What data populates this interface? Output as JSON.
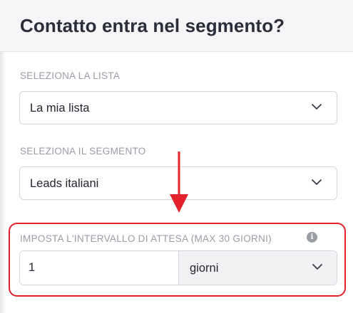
{
  "panel": {
    "title": "Contatto entra nel segmento?"
  },
  "list_field": {
    "label": "SELEZIONA LA LISTA",
    "value": "La mia lista"
  },
  "segment_field": {
    "label": "SELEZIONA IL SEGMENTO",
    "value": "Leads italiani"
  },
  "wait_field": {
    "label": "IMPOSTA L'INTERVALLO DI ATTESA (MAX 30 GIORNI)",
    "info_glyph": "i",
    "amount": "1",
    "unit": "giorni"
  },
  "colors": {
    "annotation_red": "#e5212b",
    "label_gray": "#9a9ca6",
    "header_bg": "#f6f6f8"
  },
  "icons": [
    "chevron-down-icon",
    "info-icon",
    "down-arrow-annotation"
  ]
}
